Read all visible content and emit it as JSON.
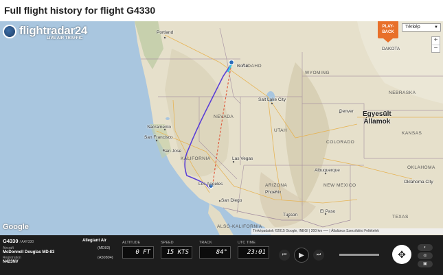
{
  "page_title": "Full flight history for flight G4330",
  "logo": {
    "name": "flightradar24",
    "tagline": "LIVE AIR TRAFFIC"
  },
  "playback": {
    "line1": "PLAY-",
    "line2": "BACK"
  },
  "map_type": {
    "selected": "Térkép"
  },
  "zoom": {
    "in": "+",
    "out": "−"
  },
  "map_labels": {
    "cities": {
      "portland": "Portland",
      "boise": "Boise",
      "salt_lake_city": "Salt Lake City",
      "sacramento": "Sacramento",
      "san_francisco": "San Francisco",
      "san_jose": "San Jose",
      "las_vegas": "Las Vegas",
      "los_angeles": "Los Angeles",
      "san_diego": "San Diego",
      "phoenix": "Phoenix",
      "tucson": "Tucson",
      "albuquerque": "Albuquerque",
      "el_paso": "El Paso",
      "denver": "Denver",
      "dakota": "DAKOTA",
      "oklahoma_city": "Oklahoma City"
    },
    "states": {
      "idaho": "IDAHO",
      "wyoming": "WYOMING",
      "nebraska": "NEBRASKA",
      "nevada": "NEVADA",
      "utah": "UTAH",
      "colorado": "COLORADO",
      "kansas": "KANSAS",
      "oklahoma": "OKLAHOMA",
      "kalifornia": "KALIFORNIA",
      "arizona": "ARIZONA",
      "new_mexico": "NEW MEXICO",
      "texas": "TEXAS",
      "dal_kalifornia": "ALSÓ-KALIFORNIA"
    },
    "country_line1": "Egyesült",
    "country_line2": "Államok"
  },
  "google_logo": "Google",
  "attribution": "Térképadatok ©2015 Google, INEGI | 200 km ⎯⎯⎯ | Általános Szerződési Feltételek",
  "flight": {
    "flight_number": "G4330",
    "callsign": "/ AAY330",
    "airline": "Allegiant Air",
    "aircraft_label": "Aircraft",
    "aircraft": "McDonnell Douglas MD-83",
    "aircraft_code": "(MD83)",
    "registration_label": "Registration",
    "registration": "N423NV",
    "mode_s": "(A50804)"
  },
  "readouts": {
    "altitude_label": "ALTITUDE",
    "altitude": "0 FT",
    "speed_label": "SPEED",
    "speed": "15 KTS",
    "track_label": "TRACK",
    "track": "84°",
    "time_label": "UTC TIME",
    "time": "23:01"
  },
  "playback_controls": {
    "rewind": "⏮",
    "play": "▶",
    "forward": "⏭",
    "pan": "✥"
  },
  "colors": {
    "land": "#e8e2cf",
    "water": "#a9c6df",
    "track_line": "#5b3fd6",
    "great_circle": "#e05a3c",
    "panel": "#1d1d1d",
    "playback": "#e8702a"
  }
}
